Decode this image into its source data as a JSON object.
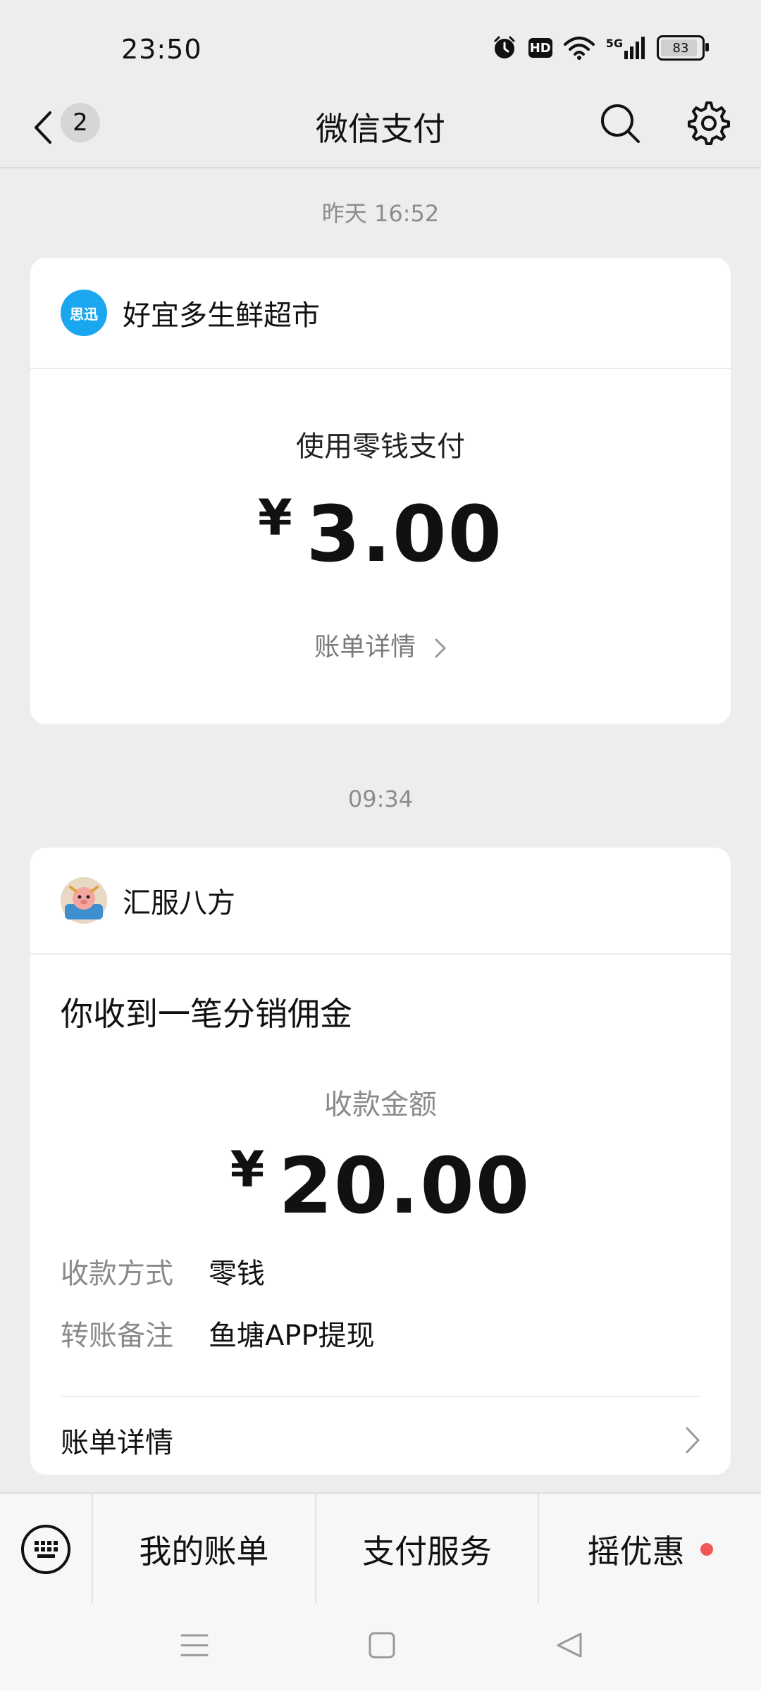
{
  "status_bar": {
    "time": "23:50",
    "battery": "83",
    "battery_level": 0.83,
    "network": "5G",
    "hd_label": "HD",
    "icons": [
      "alarm-icon",
      "hd-icon",
      "wifi-icon",
      "signal-icon",
      "battery-icon"
    ]
  },
  "nav": {
    "back_count": "2",
    "title": "微信支付",
    "icons": [
      "back-chevron-icon",
      "search-icon",
      "gear-icon"
    ]
  },
  "messages": [
    {
      "timestamp": "昨天 16:52",
      "merchant_name": "好宜多生鲜超市",
      "merchant_logo_text": "思迅",
      "merchant_logo_color": "#1aa7f0",
      "pay_method": "使用零钱支付",
      "currency": "¥",
      "amount": "3.00",
      "bill_link": "账单详情"
    },
    {
      "timestamp": "09:34",
      "merchant_name": "汇服八方",
      "notice_title": "你收到一笔分销佣金",
      "amount_label": "收款金额",
      "currency": "¥",
      "amount": "20.00",
      "details": [
        {
          "key": "收款方式",
          "value": "零钱"
        },
        {
          "key": "转账备注",
          "value": "鱼塘APP提现"
        }
      ],
      "bill_link": "账单详情"
    }
  ],
  "bottom_menu": {
    "items": [
      "我的账单",
      "支付服务",
      "摇优惠"
    ],
    "accent_dot_color": "#f25757"
  },
  "system_nav": [
    "menu-icon",
    "home-square-icon",
    "back-triangle-icon"
  ]
}
